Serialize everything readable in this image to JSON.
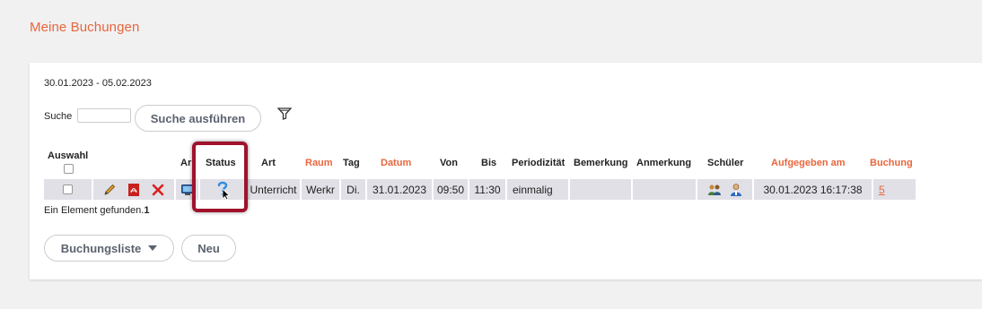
{
  "page": {
    "title": "Meine Buchungen"
  },
  "panel": {
    "date_range": "30.01.2023 - 05.02.2023",
    "search_label": "Suche",
    "search_value": "",
    "search_button": "Suche ausführen"
  },
  "table": {
    "headers": {
      "auswahl": "Auswahl",
      "ar": "Ar",
      "status": "Status",
      "art": "Art",
      "raum": "Raum",
      "tag": "Tag",
      "datum": "Datum",
      "von": "Von",
      "bis": "Bis",
      "periodizitaet": "Periodizität",
      "bemerkung": "Bemerkung",
      "anmerkung": "Anmerkung",
      "schueler": "Schüler",
      "aufgegeben": "Aufgegeben am",
      "buchung": "Buchung"
    },
    "rows": [
      {
        "art": "Unterricht",
        "raum": "Werkr",
        "tag": "Di.",
        "datum": "31.01.2023",
        "von": "09:50",
        "bis": "11:30",
        "periodizitaet": "einmalig",
        "bemerkung": "",
        "anmerkung": "",
        "aufgegeben": "30.01.2023 16:17:38",
        "buchung": "5"
      }
    ],
    "found_text": "Ein Element gefunden.",
    "found_count": "1"
  },
  "buttons": {
    "list": "Buchungsliste",
    "new": "Neu"
  },
  "colors": {
    "accent": "#e8663d",
    "highlight": "#a0122c",
    "row_bg": "#e0e0e6"
  }
}
